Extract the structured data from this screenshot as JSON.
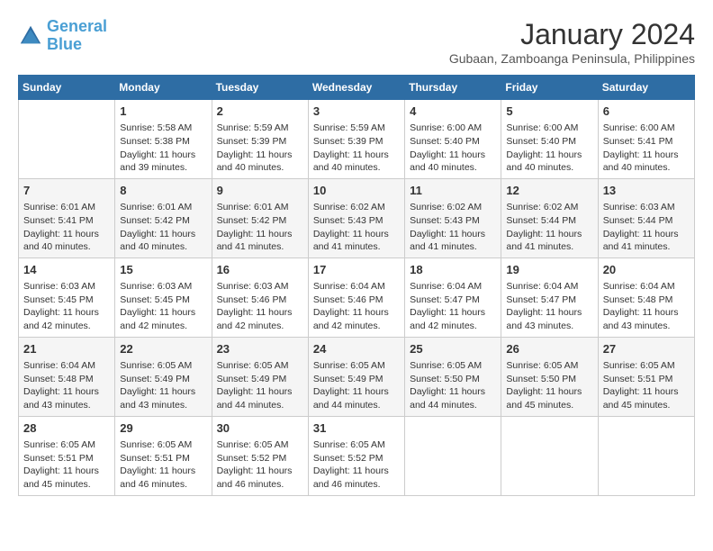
{
  "header": {
    "logo_line1": "General",
    "logo_line2": "Blue",
    "month": "January 2024",
    "location": "Gubaan, Zamboanga Peninsula, Philippines"
  },
  "days_of_week": [
    "Sunday",
    "Monday",
    "Tuesday",
    "Wednesday",
    "Thursday",
    "Friday",
    "Saturday"
  ],
  "weeks": [
    [
      {
        "day": "",
        "info": ""
      },
      {
        "day": "1",
        "info": "Sunrise: 5:58 AM\nSunset: 5:38 PM\nDaylight: 11 hours\nand 39 minutes."
      },
      {
        "day": "2",
        "info": "Sunrise: 5:59 AM\nSunset: 5:39 PM\nDaylight: 11 hours\nand 40 minutes."
      },
      {
        "day": "3",
        "info": "Sunrise: 5:59 AM\nSunset: 5:39 PM\nDaylight: 11 hours\nand 40 minutes."
      },
      {
        "day": "4",
        "info": "Sunrise: 6:00 AM\nSunset: 5:40 PM\nDaylight: 11 hours\nand 40 minutes."
      },
      {
        "day": "5",
        "info": "Sunrise: 6:00 AM\nSunset: 5:40 PM\nDaylight: 11 hours\nand 40 minutes."
      },
      {
        "day": "6",
        "info": "Sunrise: 6:00 AM\nSunset: 5:41 PM\nDaylight: 11 hours\nand 40 minutes."
      }
    ],
    [
      {
        "day": "7",
        "info": "Sunrise: 6:01 AM\nSunset: 5:41 PM\nDaylight: 11 hours\nand 40 minutes."
      },
      {
        "day": "8",
        "info": "Sunrise: 6:01 AM\nSunset: 5:42 PM\nDaylight: 11 hours\nand 40 minutes."
      },
      {
        "day": "9",
        "info": "Sunrise: 6:01 AM\nSunset: 5:42 PM\nDaylight: 11 hours\nand 41 minutes."
      },
      {
        "day": "10",
        "info": "Sunrise: 6:02 AM\nSunset: 5:43 PM\nDaylight: 11 hours\nand 41 minutes."
      },
      {
        "day": "11",
        "info": "Sunrise: 6:02 AM\nSunset: 5:43 PM\nDaylight: 11 hours\nand 41 minutes."
      },
      {
        "day": "12",
        "info": "Sunrise: 6:02 AM\nSunset: 5:44 PM\nDaylight: 11 hours\nand 41 minutes."
      },
      {
        "day": "13",
        "info": "Sunrise: 6:03 AM\nSunset: 5:44 PM\nDaylight: 11 hours\nand 41 minutes."
      }
    ],
    [
      {
        "day": "14",
        "info": "Sunrise: 6:03 AM\nSunset: 5:45 PM\nDaylight: 11 hours\nand 42 minutes."
      },
      {
        "day": "15",
        "info": "Sunrise: 6:03 AM\nSunset: 5:45 PM\nDaylight: 11 hours\nand 42 minutes."
      },
      {
        "day": "16",
        "info": "Sunrise: 6:03 AM\nSunset: 5:46 PM\nDaylight: 11 hours\nand 42 minutes."
      },
      {
        "day": "17",
        "info": "Sunrise: 6:04 AM\nSunset: 5:46 PM\nDaylight: 11 hours\nand 42 minutes."
      },
      {
        "day": "18",
        "info": "Sunrise: 6:04 AM\nSunset: 5:47 PM\nDaylight: 11 hours\nand 42 minutes."
      },
      {
        "day": "19",
        "info": "Sunrise: 6:04 AM\nSunset: 5:47 PM\nDaylight: 11 hours\nand 43 minutes."
      },
      {
        "day": "20",
        "info": "Sunrise: 6:04 AM\nSunset: 5:48 PM\nDaylight: 11 hours\nand 43 minutes."
      }
    ],
    [
      {
        "day": "21",
        "info": "Sunrise: 6:04 AM\nSunset: 5:48 PM\nDaylight: 11 hours\nand 43 minutes."
      },
      {
        "day": "22",
        "info": "Sunrise: 6:05 AM\nSunset: 5:49 PM\nDaylight: 11 hours\nand 43 minutes."
      },
      {
        "day": "23",
        "info": "Sunrise: 6:05 AM\nSunset: 5:49 PM\nDaylight: 11 hours\nand 44 minutes."
      },
      {
        "day": "24",
        "info": "Sunrise: 6:05 AM\nSunset: 5:49 PM\nDaylight: 11 hours\nand 44 minutes."
      },
      {
        "day": "25",
        "info": "Sunrise: 6:05 AM\nSunset: 5:50 PM\nDaylight: 11 hours\nand 44 minutes."
      },
      {
        "day": "26",
        "info": "Sunrise: 6:05 AM\nSunset: 5:50 PM\nDaylight: 11 hours\nand 45 minutes."
      },
      {
        "day": "27",
        "info": "Sunrise: 6:05 AM\nSunset: 5:51 PM\nDaylight: 11 hours\nand 45 minutes."
      }
    ],
    [
      {
        "day": "28",
        "info": "Sunrise: 6:05 AM\nSunset: 5:51 PM\nDaylight: 11 hours\nand 45 minutes."
      },
      {
        "day": "29",
        "info": "Sunrise: 6:05 AM\nSunset: 5:51 PM\nDaylight: 11 hours\nand 46 minutes."
      },
      {
        "day": "30",
        "info": "Sunrise: 6:05 AM\nSunset: 5:52 PM\nDaylight: 11 hours\nand 46 minutes."
      },
      {
        "day": "31",
        "info": "Sunrise: 6:05 AM\nSunset: 5:52 PM\nDaylight: 11 hours\nand 46 minutes."
      },
      {
        "day": "",
        "info": ""
      },
      {
        "day": "",
        "info": ""
      },
      {
        "day": "",
        "info": ""
      }
    ]
  ]
}
